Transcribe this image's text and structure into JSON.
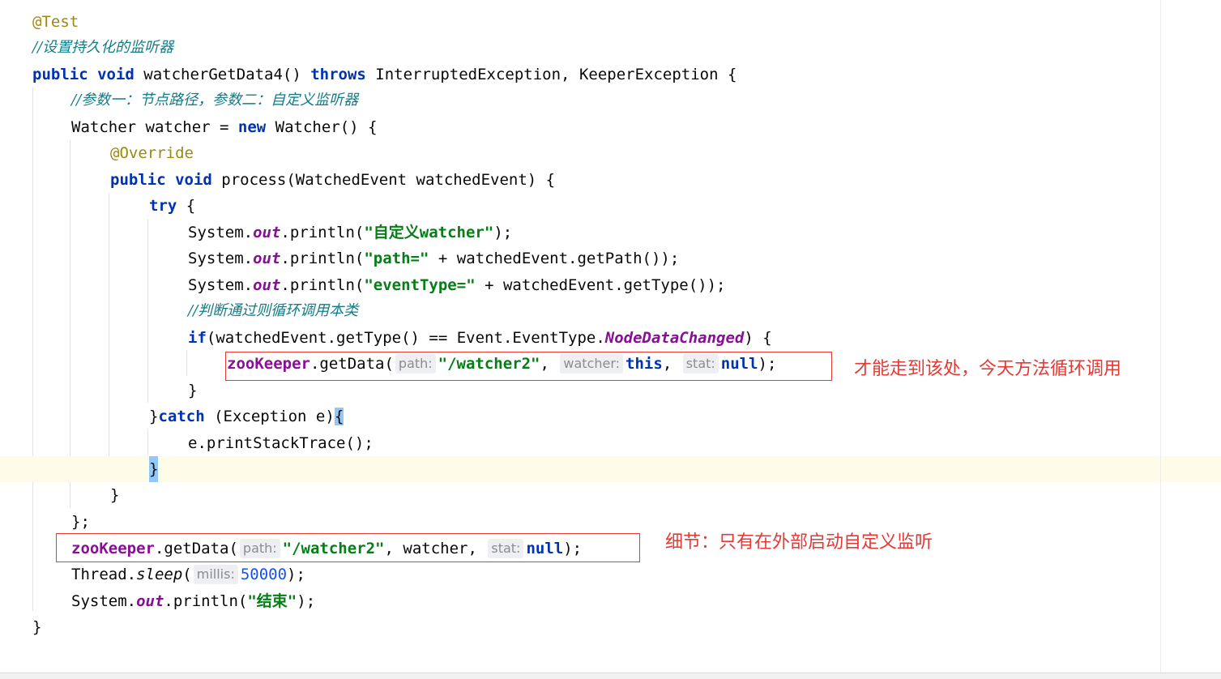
{
  "lines": [
    {
      "text": "@Test"
    },
    {
      "text": "//设置持久化的监听器"
    },
    {
      "p1": "public",
      "p2": "void",
      "p3": " watcherGetData4() ",
      "p4": "throws",
      "p5": " InterruptedException, KeeperException {"
    },
    {
      "text": "//参数一：节点路径，参数二：自定义监听器"
    },
    {
      "p1": "Watcher watcher = ",
      "p2": "new",
      "p3": " Watcher() {"
    },
    {
      "text": "@Override"
    },
    {
      "p1": "public",
      "p2": "void",
      "p3": " process(WatchedEvent watchedEvent) {"
    },
    {
      "p1": "try",
      "p2": " {"
    },
    {
      "p1": "System.",
      "p2": "out",
      "p3": ".println(",
      "p4": "\"自定义watcher\"",
      "p5": ");"
    },
    {
      "p1": "System.",
      "p2": "out",
      "p3": ".println(",
      "p4": "\"path=\"",
      "p5": " + watchedEvent.getPath());"
    },
    {
      "p1": "System.",
      "p2": "out",
      "p3": ".println(",
      "p4": "\"eventType=\"",
      "p5": " + watchedEvent.getType());"
    },
    {
      "text": "//判断通过则循环调用本类"
    },
    {
      "p1": "if",
      "p2": "(watchedEvent.getType() == Event.EventType.",
      "p3": "NodeDataChanged",
      "p4": ") {"
    },
    {
      "p1": "zooKeeper",
      "p2": ".getData(",
      "h1": "path:",
      "p3": "\"/watcher2\"",
      "p4": ", ",
      "h2": "watcher:",
      "p5": "this",
      "p6": ", ",
      "h3": "stat:",
      "p7": "null",
      "p8": ");"
    },
    {
      "text": "}"
    },
    {
      "p1": "}",
      "p2": "catch",
      "p3": " (Exception e)",
      "p4": "{"
    },
    {
      "text": "e.printStackTrace();"
    },
    {
      "text": "}"
    },
    {
      "text": "}"
    },
    {
      "text": "};"
    },
    {
      "p1": "zooKeeper",
      "p2": ".getData(",
      "h1": "path:",
      "p3": "\"/watcher2\"",
      "p4": ", watcher, ",
      "h2": "stat:",
      "p5": "null",
      "p6": ");"
    },
    {
      "p1": "Thread.",
      "p2": "sleep",
      "p3": "(",
      "h1": "millis:",
      "p4": "50000",
      "p5": ");"
    },
    {
      "p1": "System.",
      "p2": "out",
      "p3": ".println(",
      "p4": "\"结束\"",
      "p5": ");"
    },
    {
      "text": "}"
    }
  ],
  "notes": {
    "inner_call": "才能走到该处，今天方法循环调用",
    "outer_call": "细节：只有在外部启动自定义监听"
  },
  "colors": {
    "annotation_box": "#e53935",
    "keyword": "#0033b3",
    "string": "#067d17",
    "comment": "#137c87",
    "field": "#871094"
  }
}
